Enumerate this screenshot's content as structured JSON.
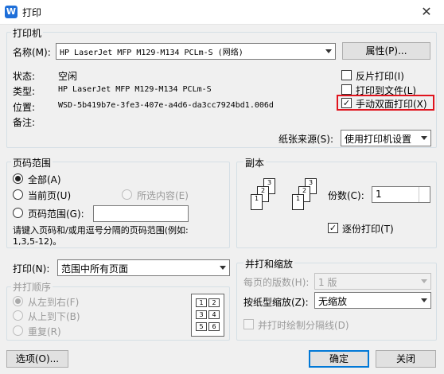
{
  "window": {
    "title": "打印",
    "app_icon_glyph": "W"
  },
  "printer": {
    "group_label": "打印机",
    "name_label": "名称(M):",
    "name_value": "HP LaserJet MFP M129-M134 PCLm-S (网络)",
    "properties_button": "属性(P)...",
    "status_label": "状态:",
    "status_value": "空闲",
    "type_label": "类型:",
    "type_value": "HP LaserJet MFP M129-M134 PCLm-S",
    "location_label": "位置:",
    "location_value": "WSD-5b419b7e-3fe3-407e-a4d6-da3cc7924bd1.006d",
    "comment_label": "备注:",
    "reverse_print": {
      "label": "反片打印(I)",
      "checked": false
    },
    "print_to_file": {
      "label": "打印到文件(L)",
      "checked": false
    },
    "manual_duplex": {
      "label": "手动双面打印(X)",
      "checked": true
    },
    "paper_source_label": "纸张来源(S):",
    "paper_source_value": "使用打印机设置"
  },
  "page_range": {
    "group_label": "页码范围",
    "all": "全部(A)",
    "current": "当前页(U)",
    "selection": "所选内容(E)",
    "range": "页码范围(G):",
    "hint": "请键入页码和/或用逗号分隔的页码范围(例如:\n1,3,5-12)。"
  },
  "copies": {
    "group_label": "副本",
    "count_label": "份数(C):",
    "count_value": "1",
    "collate": {
      "label": "逐份打印(T)",
      "checked": true
    }
  },
  "print_what": {
    "label": "打印(N):",
    "value": "范围中所有页面"
  },
  "order": {
    "group_label": "并打顺序",
    "left_to_right": "从左到右(F)",
    "top_to_bottom": "从上到下(B)",
    "repeat": "重复(R)",
    "grid_numbers": [
      "1",
      "2",
      "3",
      "4",
      "5",
      "6"
    ]
  },
  "zoom": {
    "group_label": "并打和缩放",
    "pages_per_sheet_label": "每页的版数(H):",
    "pages_per_sheet_value": "1 版",
    "scale_label": "按纸型缩放(Z):",
    "scale_value": "无缩放",
    "draw_borders": {
      "label": "并打时绘制分隔线(D)",
      "checked": false
    }
  },
  "footer": {
    "options_button": "选项(O)...",
    "ok_button": "确定",
    "close_button": "关闭"
  },
  "copies_icon_pages": [
    "1",
    "2",
    "3"
  ],
  "accent_colors": {
    "highlight_box": "#e0141e",
    "focus_border": "#0078d7"
  }
}
